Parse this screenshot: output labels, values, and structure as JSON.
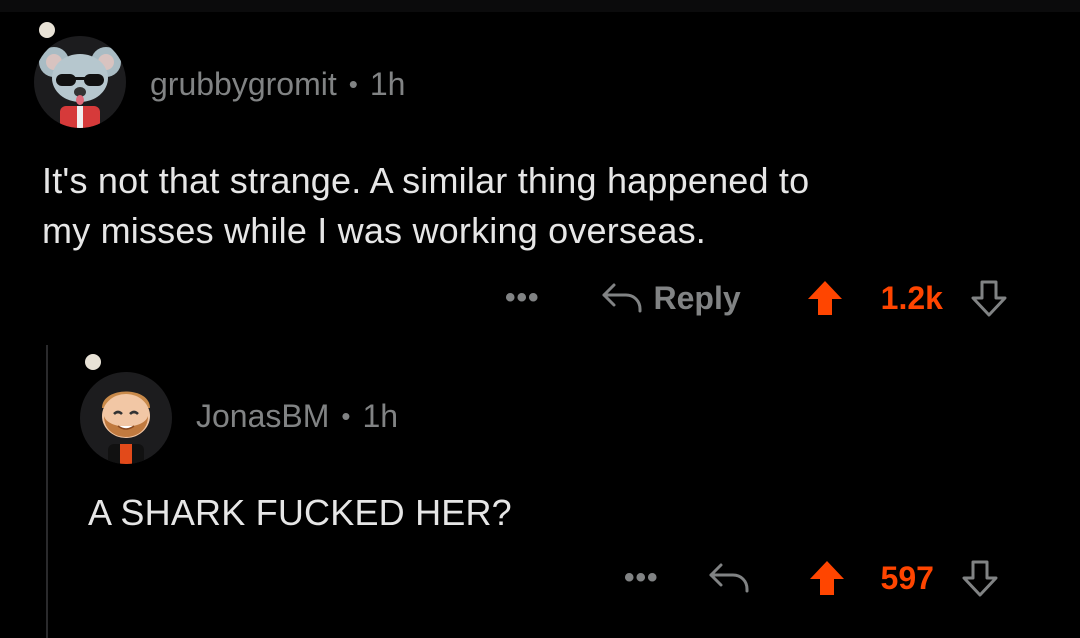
{
  "colors": {
    "background": "#000000",
    "upvote": "#ff4500",
    "muted": "#818384",
    "text": "#e6e6e6"
  },
  "comments": [
    {
      "username": "grubbygromit",
      "separator": "•",
      "age": "1h",
      "body_lines": [
        "It's not that strange. A similar thing happened to",
        "my misses while I was working overseas."
      ],
      "more": "•••",
      "reply_label": "Reply",
      "score": "1.2k",
      "icons": [
        "more-icon",
        "reply-arrow-icon",
        "upvote-icon",
        "downvote-icon"
      ]
    },
    {
      "username": "JonasBM",
      "separator": "•",
      "age": "1h",
      "body_lines": [
        "A SHARK FUCKED HER?"
      ],
      "more": "•••",
      "score": "597",
      "icons": [
        "more-icon",
        "reply-arrow-icon",
        "upvote-icon",
        "downvote-icon"
      ]
    }
  ]
}
